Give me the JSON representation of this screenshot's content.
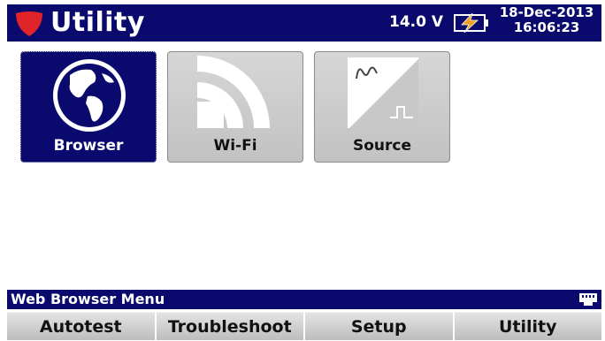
{
  "header": {
    "title": "Utility",
    "voltage": "14.0 V",
    "date": "18-Dec-2013",
    "time": "16:06:23",
    "battery_icon": "battery-charging-icon",
    "logo_icon": "shield-logo-icon"
  },
  "tiles": [
    {
      "label": "Browser",
      "icon": "globe-icon",
      "selected": true
    },
    {
      "label": "Wi-Fi",
      "icon": "wifi-icon",
      "selected": false
    },
    {
      "label": "Source",
      "icon": "signal-source-icon",
      "selected": false
    }
  ],
  "status": {
    "text": "Web Browser Menu",
    "icon": "ethernet-icon"
  },
  "softkeys": [
    {
      "label": "Autotest"
    },
    {
      "label": "Troubleshoot"
    },
    {
      "label": "Setup"
    },
    {
      "label": "Utility"
    }
  ],
  "colors": {
    "header_bg": "#0a0a6e",
    "logo": "#e0242a",
    "battery_bolt": "#f0a020",
    "selected_tile_bg": "#0a0a6e",
    "tile_bg": "#cfcfcf"
  }
}
